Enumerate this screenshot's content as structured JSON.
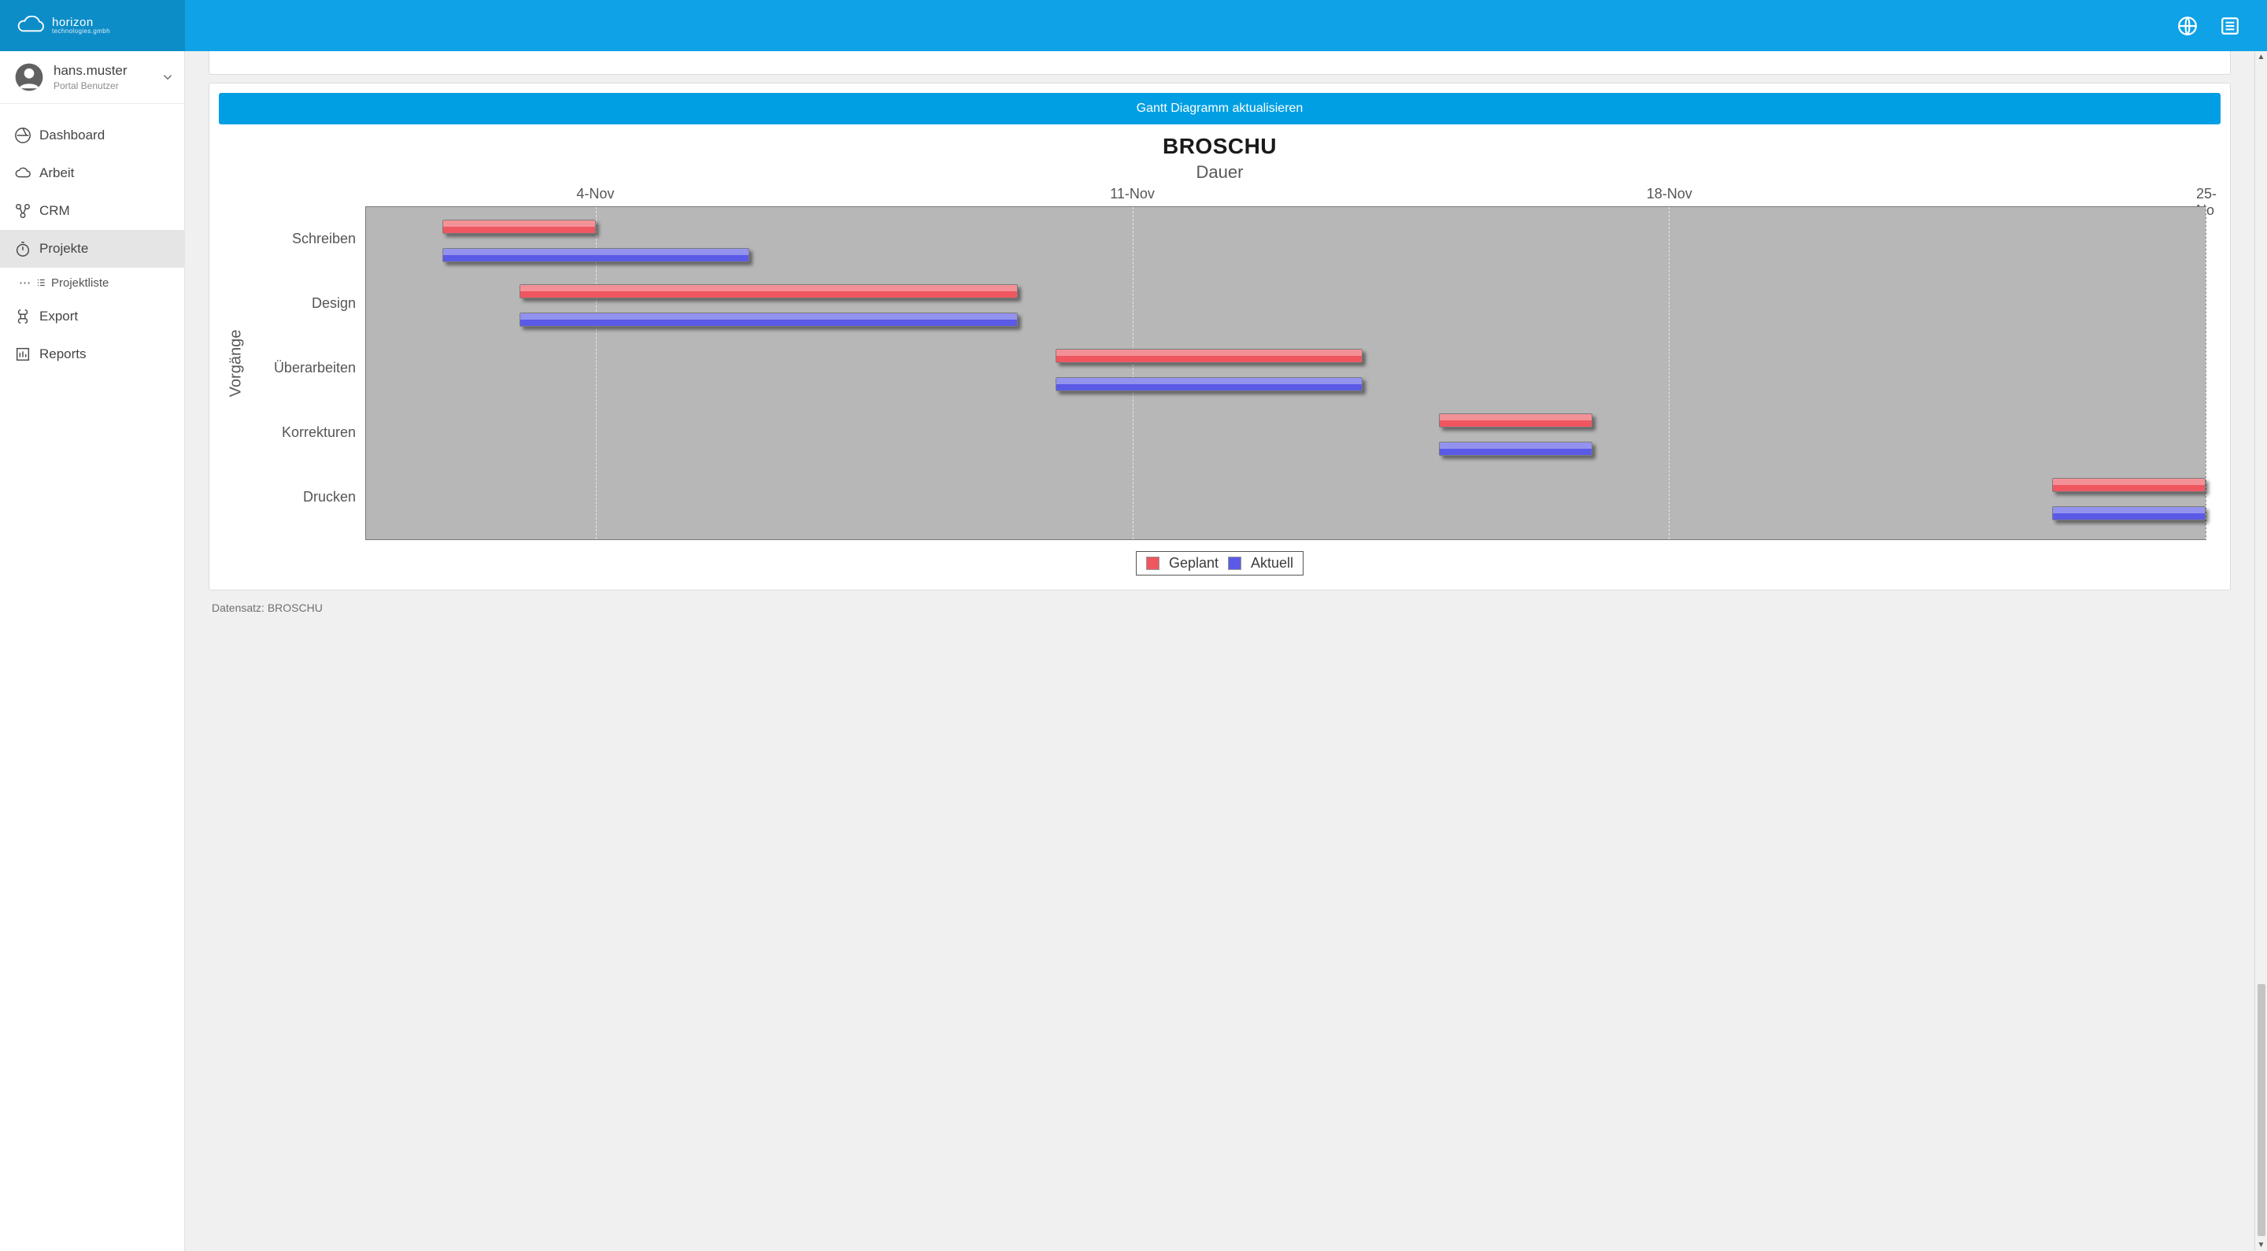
{
  "brand": {
    "name": "horizon",
    "sub": "technologies.gmbh"
  },
  "topbar": {
    "globe": "globe-icon",
    "list": "list-icon"
  },
  "user": {
    "name": "hans.muster",
    "role": "Portal Benutzer"
  },
  "nav": {
    "items": [
      {
        "label": "Dashboard",
        "icon": "dashboard"
      },
      {
        "label": "Arbeit",
        "icon": "cloud"
      },
      {
        "label": "CRM",
        "icon": "crm"
      },
      {
        "label": "Projekte",
        "icon": "stopwatch",
        "active": true,
        "sub": [
          {
            "label": "Projektliste"
          }
        ]
      },
      {
        "label": "Export",
        "icon": "command"
      },
      {
        "label": "Reports",
        "icon": "report"
      }
    ]
  },
  "main": {
    "refresh_btn": "Gantt Diagramm aktualisieren",
    "footer": "Datensatz: BROSCHU"
  },
  "chart_data": {
    "type": "gantt-bar",
    "title": "BROSCHU",
    "xlabel": "Dauer",
    "ylabel": "Vorgänge",
    "x_axis": {
      "start": "1-Nov",
      "end": "25-Nov",
      "ticks": [
        "4-Nov",
        "11-Nov",
        "18-Nov",
        "25-No"
      ]
    },
    "categories": [
      "Schreiben",
      "Design",
      "Überarbeiten",
      "Korrekturen",
      "Drucken"
    ],
    "series": [
      {
        "name": "Geplant",
        "color": "#ef5660",
        "bars": [
          {
            "task": "Schreiben",
            "start": 2,
            "end": 4
          },
          {
            "task": "Design",
            "start": 3,
            "end": 9.5
          },
          {
            "task": "Überarbeiten",
            "start": 10,
            "end": 14
          },
          {
            "task": "Korrekturen",
            "start": 15,
            "end": 17
          },
          {
            "task": "Drucken",
            "start": 23,
            "end": 25
          }
        ]
      },
      {
        "name": "Aktuell",
        "color": "#5a5ae6",
        "bars": [
          {
            "task": "Schreiben",
            "start": 2,
            "end": 6
          },
          {
            "task": "Design",
            "start": 3,
            "end": 9.5
          },
          {
            "task": "Überarbeiten",
            "start": 10,
            "end": 14
          },
          {
            "task": "Korrekturen",
            "start": 15,
            "end": 17
          },
          {
            "task": "Drucken",
            "start": 23,
            "end": 25
          }
        ]
      }
    ],
    "legend": [
      "Geplant",
      "Aktuell"
    ]
  }
}
